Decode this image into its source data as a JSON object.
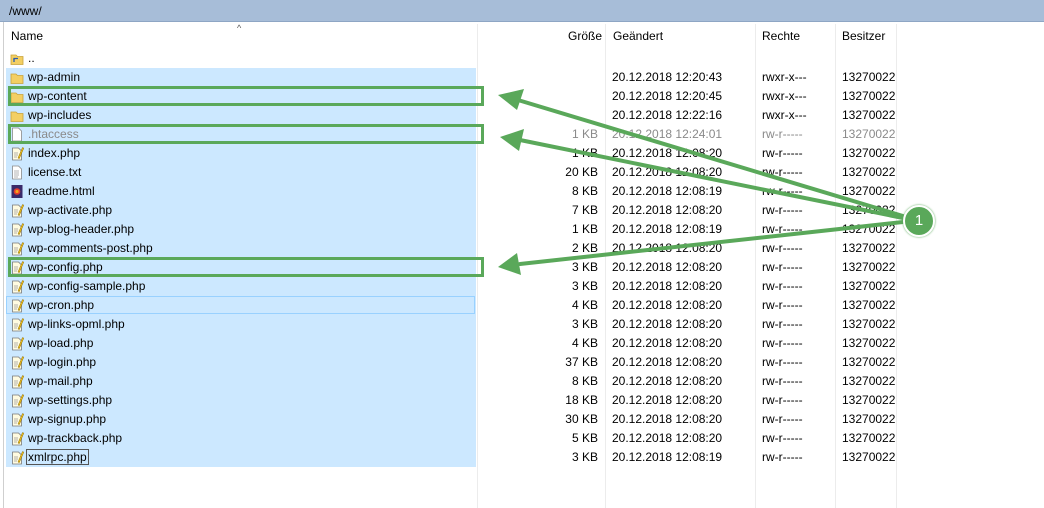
{
  "path": "/www/",
  "columns": {
    "name": "Name",
    "size": "Größe",
    "modified": "Geändert",
    "rights": "Rechte",
    "owner": "Besitzer"
  },
  "parent": "..",
  "files": [
    {
      "name": "wp-admin",
      "size": "",
      "date": "20.12.2018 12:20:43",
      "perm": "rwxr-x---",
      "owner": "13270022",
      "icon": "folder-icon"
    },
    {
      "name": "wp-content",
      "size": "",
      "date": "20.12.2018 12:20:45",
      "perm": "rwxr-x---",
      "owner": "13270022",
      "icon": "folder-icon"
    },
    {
      "name": "wp-includes",
      "size": "",
      "date": "20.12.2018 12:22:16",
      "perm": "rwxr-x---",
      "owner": "13270022",
      "icon": "folder-icon"
    },
    {
      "name": ".htaccess",
      "size": "1 KB",
      "date": "20.12.2018 12:24:01",
      "perm": "rw-r-----",
      "owner": "13270022",
      "icon": "file-icon"
    },
    {
      "name": "index.php",
      "size": "1 KB",
      "date": "20.12.2018 12:08:20",
      "perm": "rw-r-----",
      "owner": "13270022",
      "icon": "php-file-icon"
    },
    {
      "name": "license.txt",
      "size": "20 KB",
      "date": "20.12.2018 12:08:20",
      "perm": "rw-r-----",
      "owner": "13270022",
      "icon": "text-file-icon"
    },
    {
      "name": "readme.html",
      "size": "8 KB",
      "date": "20.12.2018 12:08:19",
      "perm": "rw-r-----",
      "owner": "13270022",
      "icon": "html-file-icon"
    },
    {
      "name": "wp-activate.php",
      "size": "7 KB",
      "date": "20.12.2018 12:08:20",
      "perm": "rw-r-----",
      "owner": "13270022",
      "icon": "php-file-icon"
    },
    {
      "name": "wp-blog-header.php",
      "size": "1 KB",
      "date": "20.12.2018 12:08:19",
      "perm": "rw-r-----",
      "owner": "13270022",
      "icon": "php-file-icon"
    },
    {
      "name": "wp-comments-post.php",
      "size": "2 KB",
      "date": "20.12.2018 12:08:20",
      "perm": "rw-r-----",
      "owner": "13270022",
      "icon": "php-file-icon"
    },
    {
      "name": "wp-config.php",
      "size": "3 KB",
      "date": "20.12.2018 12:08:20",
      "perm": "rw-r-----",
      "owner": "13270022",
      "icon": "php-file-icon"
    },
    {
      "name": "wp-config-sample.php",
      "size": "3 KB",
      "date": "20.12.2018 12:08:20",
      "perm": "rw-r-----",
      "owner": "13270022",
      "icon": "php-file-icon"
    },
    {
      "name": "wp-cron.php",
      "size": "4 KB",
      "date": "20.12.2018 12:08:20",
      "perm": "rw-r-----",
      "owner": "13270022",
      "icon": "php-file-icon"
    },
    {
      "name": "wp-links-opml.php",
      "size": "3 KB",
      "date": "20.12.2018 12:08:20",
      "perm": "rw-r-----",
      "owner": "13270022",
      "icon": "php-file-icon"
    },
    {
      "name": "wp-load.php",
      "size": "4 KB",
      "date": "20.12.2018 12:08:20",
      "perm": "rw-r-----",
      "owner": "13270022",
      "icon": "php-file-icon"
    },
    {
      "name": "wp-login.php",
      "size": "37 KB",
      "date": "20.12.2018 12:08:20",
      "perm": "rw-r-----",
      "owner": "13270022",
      "icon": "php-file-icon"
    },
    {
      "name": "wp-mail.php",
      "size": "8 KB",
      "date": "20.12.2018 12:08:20",
      "perm": "rw-r-----",
      "owner": "13270022",
      "icon": "php-file-icon"
    },
    {
      "name": "wp-settings.php",
      "size": "18 KB",
      "date": "20.12.2018 12:08:20",
      "perm": "rw-r-----",
      "owner": "13270022",
      "icon": "php-file-icon"
    },
    {
      "name": "wp-signup.php",
      "size": "30 KB",
      "date": "20.12.2018 12:08:20",
      "perm": "rw-r-----",
      "owner": "13270022",
      "icon": "php-file-icon"
    },
    {
      "name": "wp-trackback.php",
      "size": "5 KB",
      "date": "20.12.2018 12:08:20",
      "perm": "rw-r-----",
      "owner": "13270022",
      "icon": "php-file-icon"
    },
    {
      "name": "xmlrpc.php",
      "size": "3 KB",
      "date": "20.12.2018 12:08:19",
      "perm": "rw-r-----",
      "owner": "13270022",
      "icon": "php-file-icon"
    }
  ],
  "annotation": {
    "badge": "1",
    "color": "#5aa85a"
  },
  "colors": {
    "selection": "#cce8ff",
    "pathbar": "#a7bdd8",
    "highlight": "#5aa85a"
  }
}
